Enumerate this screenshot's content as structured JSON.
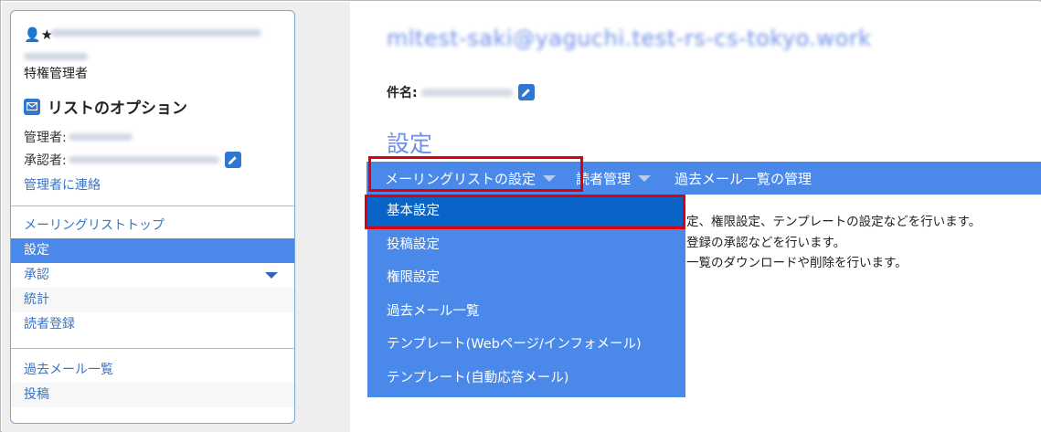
{
  "sidebar": {
    "user_icons": "👤★",
    "role": "特権管理者",
    "options_title": "リストのオプション",
    "admin_label": "管理者:",
    "approver_label": "承認者:",
    "contact_link": "管理者に連絡",
    "nav_group1": [
      {
        "label": "メーリングリストトップ",
        "active": false
      },
      {
        "label": "設定",
        "active": true
      },
      {
        "label": "承認",
        "active": false,
        "has_caret": true
      },
      {
        "label": "統計",
        "active": false
      },
      {
        "label": "読者登録",
        "active": false
      }
    ],
    "nav_group2": [
      {
        "label": "過去メール一覧"
      },
      {
        "label": "投稿"
      }
    ]
  },
  "main": {
    "list_title": "mltest-saki@yaguchi.test-rs-cs-tokyo.work",
    "subject_label": "件名:",
    "section_heading": "設定",
    "menubar": [
      {
        "label": "メーリングリストの設定",
        "has_caret": true
      },
      {
        "label": "読者管理",
        "has_caret": true
      },
      {
        "label": "過去メール一覧の管理",
        "has_caret": false
      }
    ],
    "description_lines": [
      "定、権限設定、テンプレートの設定などを行います。",
      "登録の承認などを行います。",
      "一覧のダウンロードや削除を行います。"
    ],
    "dropdown_items": [
      {
        "label": "基本設定",
        "selected": true
      },
      {
        "label": "投稿設定",
        "selected": false
      },
      {
        "label": "権限設定",
        "selected": false
      },
      {
        "label": "過去メール一覧",
        "selected": false
      },
      {
        "label": "テンプレート(Webページ/インフォメール)",
        "selected": false
      },
      {
        "label": "テンプレート(自動応答メール)",
        "selected": false
      }
    ]
  },
  "colors": {
    "accent": "#4a89ea",
    "selected_item": "#0a63c6",
    "highlight_box": "#e0000b",
    "link": "#3a73c4"
  }
}
